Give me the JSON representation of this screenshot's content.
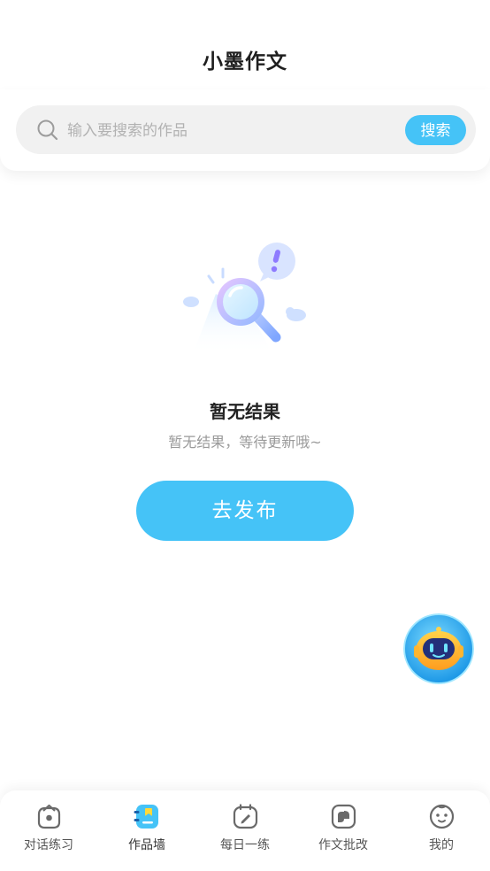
{
  "header": {
    "title": "小墨作文"
  },
  "search": {
    "placeholder": "输入要搜索的作品",
    "value": "",
    "button_label": "搜索"
  },
  "empty_state": {
    "title": "暂无结果",
    "subtitle": "暂无结果，等待更新哦~",
    "action_label": "去发布"
  },
  "tabs": [
    {
      "label": "对话练习",
      "icon": "chat-practice-icon",
      "active": false
    },
    {
      "label": "作品墙",
      "icon": "works-wall-icon",
      "active": true
    },
    {
      "label": "每日一练",
      "icon": "daily-practice-icon",
      "active": false
    },
    {
      "label": "作文批改",
      "icon": "essay-correction-icon",
      "active": false
    },
    {
      "label": "我的",
      "icon": "profile-icon",
      "active": false
    }
  ],
  "colors": {
    "accent": "#45c3f7",
    "icon_gray": "#6a6a6a",
    "background": "#ffffff"
  }
}
